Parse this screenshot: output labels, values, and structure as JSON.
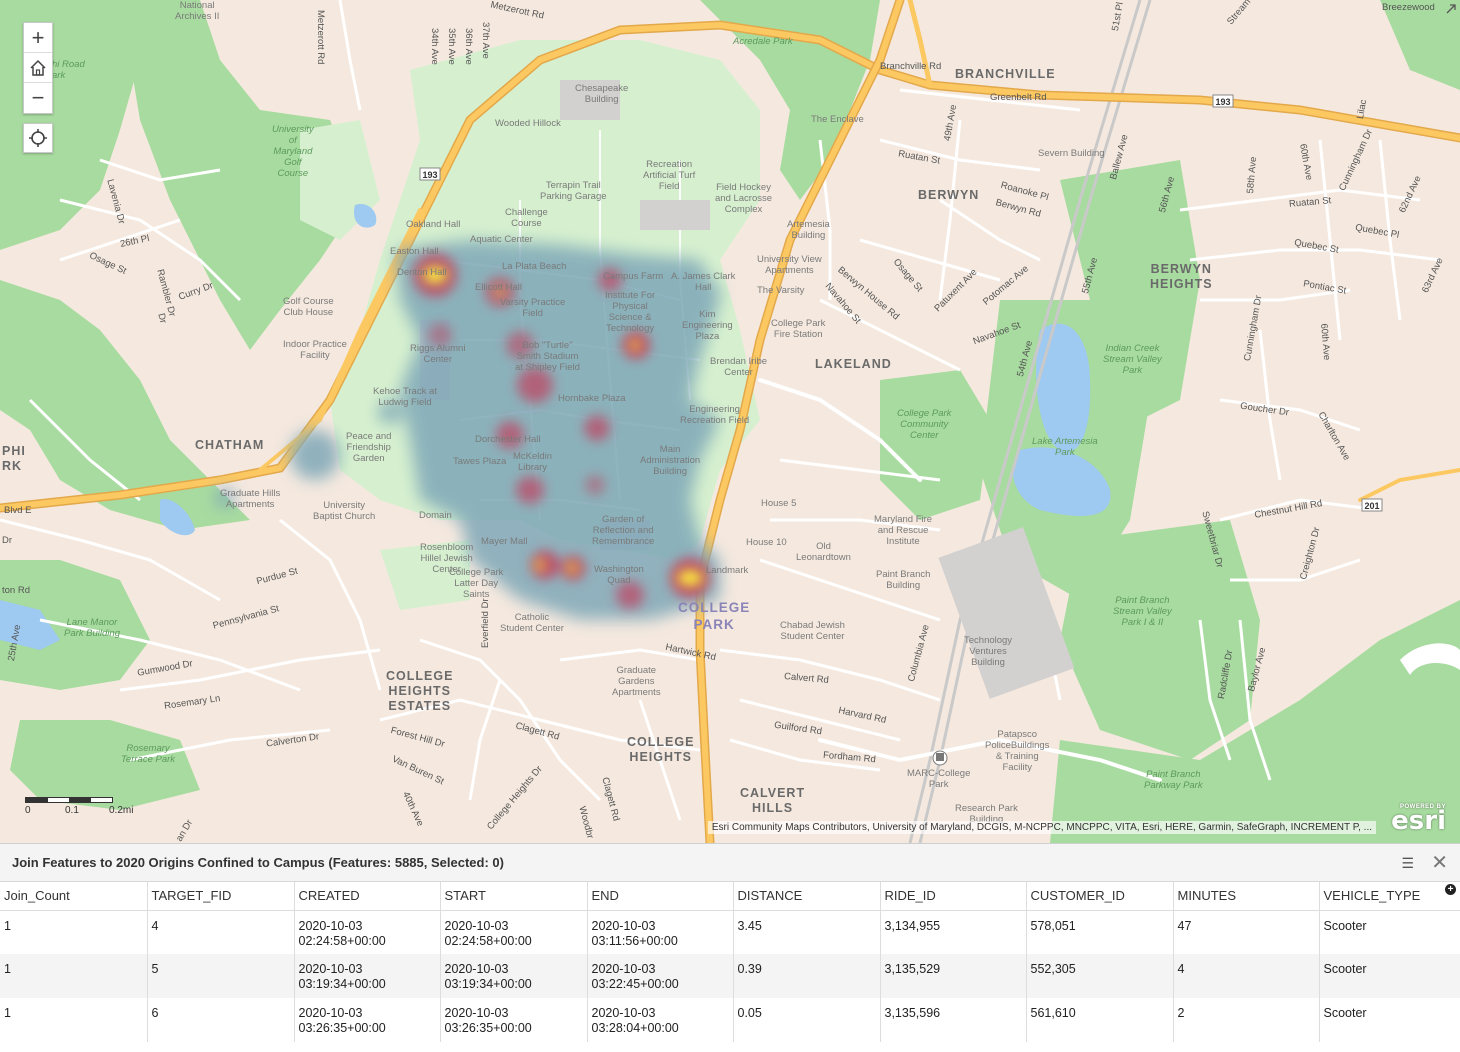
{
  "map": {
    "places": [
      "BRANCHVILLE",
      "BERWYN",
      "BERWYN\nHEIGHTS",
      "LAKELAND",
      "CHATHAM",
      "COLLEGE\nHEIGHTS\nESTATES",
      "COLLEGE\nHEIGHTS",
      "CALVERT\nHILLS",
      "PHI\nRK"
    ],
    "campus_label": "COLLEGE\nPARK",
    "parks": [
      "Acredale Park",
      "University\nof\nMaryland\nGolf\nCourse",
      "Indian Creek\nStream Valley\nPark",
      "Lake Artemesia\nPark",
      "College Park\nCommunity\nCenter",
      "Paint Branch\nStream Valley\nPark I & II",
      "Paint Branch\nParkway Park",
      "Lane Manor\nPark Building",
      "Rosemary\nTerrace Park",
      "hi Road\nark"
    ],
    "pois": [
      "Chesapeake\nBuilding",
      "Wooded Hillock",
      "Recreation\nArtificial Turf\nField",
      "Terrapin Trail\nParking Garage",
      "Field Hockey\nand Lacrosse\nComplex",
      "Challenge\nCourse",
      "Oakland Hall",
      "Aquatic Center",
      "Easton Hall",
      "Denton Hall",
      "La Plata Beach",
      "Campus Farm",
      "A. James Clark\nHall",
      "Ellicott Hall",
      "Varsity Practice\nField",
      "Institute For\nPhysical\nScience &\nTechnology",
      "Kim\nEngineering\nPlaza",
      "Golf Course\nClub House",
      "Indoor Practice\nFacility",
      "Riggs Alumni\nCenter",
      "Bob \"Turtle\"\nSmith Stadium\nat Shipley Field",
      "Brendan Iribe\nCenter",
      "Kehoe Track at\nLudwig Field",
      "Hornbake Plaza",
      "Engineering\nRecreation Field",
      "Peace and\nFriendship\nGarden",
      "Dorchester Hall",
      "Tawes Plaza",
      "McKeldin\nLibrary",
      "Main\nAdministration\nBuilding",
      "Graduate Hills\nApartments",
      "University\nBaptist Church",
      "Domain",
      "House 5",
      "Garden of\nReflection and\nRemembrance",
      "Mayer Mall",
      "Rosenbloom\nHillel Jewish\nCenter",
      "House 10",
      "Old\nLeonardtown",
      "College Park\nLatter Day\nSaints",
      "Washington\nQuad",
      "Landmark",
      "Catholic\nStudent Center",
      "Chabad Jewish\nStudent Center",
      "Graduate\nGardens\nApartments",
      "Maryland Fire\nand Rescue\nInstitute",
      "Paint Branch\nBuilding",
      "Technology\nVentures\nBuilding",
      "Patapsco\nPoliceBuildings\n& Training\nFacility",
      "MARC-College\nPark",
      "Research Park\nBuilding",
      "University View\nApartments",
      "The Varsity",
      "College Park\nFire Station",
      "Artemesia\nBuilding",
      "The Enclave",
      "Severn Building",
      "National\nArchives II"
    ],
    "streets": [
      "Metzerott Rd",
      "Metzerott Rd",
      "Branchville Rd",
      "Greenbelt Rd",
      "34th Ave",
      "35th Ave",
      "36th Ave",
      "37th Ave",
      "Lavenia Dr",
      "26th Pl",
      "Osage St",
      "Rambler Dr",
      "Curry Dr",
      "49th Ave",
      "Ruatan St",
      "Roanoke Pl",
      "Berwyn Rd",
      "Patuxent Ave",
      "Osage St",
      "Potomac Ave",
      "Berwyn House Rd",
      "Navahoe St",
      "Navahoe St",
      "Ballew Ave",
      "55th Ave",
      "54th Ave",
      "56th Ave",
      "58th Ave",
      "60th Ave",
      "Cunningham Dr",
      "62nd Ave",
      "63rd Ave",
      "Ruatan St",
      "Quebec St",
      "Quebec Pl",
      "Pontiac St",
      "Cunningham Dr",
      "60th Ave",
      "Goucher Dr",
      "Charlton Ave",
      "Chestnut Hill Rd",
      "Creighton Dr",
      "Sweetbriar Dr",
      "Radcliffe Dr",
      "Baylor Ave",
      "Blvd E",
      "Purdue St",
      "Pennsylvania St",
      "25th Ave",
      "Gumwood Dr",
      "Rosemary Ln",
      "Calverton Dr",
      "Forest Hill Dr",
      "Van Buren St",
      "40th Ave",
      "Everfield Dr",
      "College Heights Dr",
      "Clagett Rd",
      "Clagett Rd",
      "Woodbr",
      "Hartwick Rd",
      "Calvert Rd",
      "Harvard Rd",
      "Guilford Rd",
      "Fordham Rd",
      "Columbia Ave",
      "Breezewood",
      "51st Pl",
      "Stream",
      "an Dr",
      "Dr",
      "Dr",
      "ton Rd",
      "Lilac"
    ],
    "shields": [
      "193",
      "193",
      "201"
    ],
    "scale": {
      "labels": [
        "0",
        "0.1",
        "0.2mi"
      ]
    },
    "attribution": "Esri Community Maps Contributors, University of Maryland, DCGIS, M-NCPPC, MNCPPC, VITA, Esri, HERE, Garmin, SafeGraph, INCREMENT P, ...",
    "logo": {
      "powered": "POWERED BY",
      "name": "esri"
    },
    "controls": {
      "zoom_in": "+",
      "zoom_out": "−"
    }
  },
  "table": {
    "title": "Join Features to 2020 Origins Confined to Campus (Features: 5885, Selected: 0)",
    "columns": [
      "Join_Count",
      "TARGET_FID",
      "CREATED",
      "START",
      "END",
      "DISTANCE",
      "RIDE_ID",
      "CUSTOMER_ID",
      "MINUTES",
      "VEHICLE_TYPE"
    ],
    "rows": [
      [
        "1",
        "4",
        "2020-10-03\n02:24:58+00:00",
        "2020-10-03\n02:24:58+00:00",
        "2020-10-03\n03:11:56+00:00",
        "3.45",
        "3,134,955",
        "578,051",
        "47",
        "Scooter"
      ],
      [
        "1",
        "5",
        "2020-10-03\n03:19:34+00:00",
        "2020-10-03\n03:19:34+00:00",
        "2020-10-03\n03:22:45+00:00",
        "0.39",
        "3,135,529",
        "552,305",
        "4",
        "Scooter"
      ],
      [
        "1",
        "6",
        "2020-10-03\n03:26:35+00:00",
        "2020-10-03\n03:26:35+00:00",
        "2020-10-03\n03:28:04+00:00",
        "0.05",
        "3,135,596",
        "561,610",
        "2",
        "Scooter"
      ]
    ]
  },
  "colors": {
    "land": "#f5e9df",
    "park": "#a8dba0",
    "campus": "#d6f0cf",
    "water": "#9ec9f0",
    "highway": "#fcc862",
    "heat_low": "#7fa8b8",
    "heat_mid": "#c0405e",
    "heat_high": "#fff23a"
  }
}
